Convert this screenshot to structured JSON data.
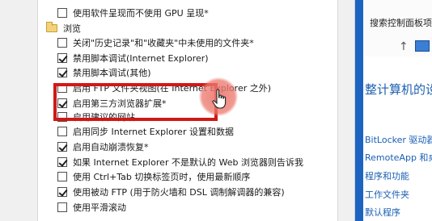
{
  "options_list": {
    "items": [
      {
        "type": "check",
        "checked": false,
        "label": "使用软件呈现而不使用 GPU 呈现*"
      },
      {
        "type": "group",
        "label": "浏览"
      },
      {
        "type": "check",
        "checked": false,
        "label": "关闭\"历史记录\"和\"收藏夹\"中未使用的文件夹*"
      },
      {
        "type": "check",
        "checked": true,
        "label": "禁用脚本调试(Internet Explorer)"
      },
      {
        "type": "check",
        "checked": true,
        "label": "禁用脚本调试(其他)"
      },
      {
        "type": "check",
        "checked": false,
        "label": "启用 FTP 文件夹视图(在 Internet Explorer 之外)"
      },
      {
        "type": "check",
        "checked": true,
        "label": "启用第三方浏览器扩展*"
      },
      {
        "type": "check",
        "checked": false,
        "label": "启用建议的网站"
      },
      {
        "type": "check",
        "checked": false,
        "label": "启用同步 Internet Explorer 设置和数据"
      },
      {
        "type": "check",
        "checked": true,
        "label": "启用自动崩溃恢复*"
      },
      {
        "type": "check",
        "checked": true,
        "label": "如果 Internet Explorer 不是默认的 Web 浏览器则告诉我"
      },
      {
        "type": "check",
        "checked": false,
        "label": "使用 Ctrl+Tab 切换标签页时，使用最新顺序"
      },
      {
        "type": "check",
        "checked": true,
        "label": "使用被动 FTP (用于防火墙和 DSL 调制解调器的兼容)"
      },
      {
        "type": "check",
        "checked": false,
        "label": "使用平滑滚动"
      }
    ]
  },
  "control_panel": {
    "search_placeholder": "搜索控制面板项",
    "heading": "整计算机的设",
    "links": [
      "BitLocker 驱动器",
      "RemoteApp 和桌",
      "程序和功能",
      "工作文件夹",
      "默认程序"
    ],
    "nav_back": "↑",
    "nav_refresh": "↻"
  },
  "colors": {
    "highlight_border": "#d01818",
    "cursor_halo": "#ec786e",
    "link_blue": "#1a5fb4"
  }
}
